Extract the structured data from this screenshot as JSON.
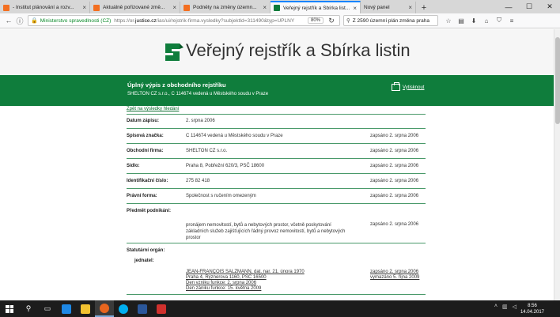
{
  "tabs": [
    {
      "title": "- Institut plánování a rozv...",
      "icon": "orange"
    },
    {
      "title": "Aktuálně pořizované změ...",
      "icon": "orange"
    },
    {
      "title": "Podněty na změny územn...",
      "icon": "orange"
    },
    {
      "title": "Veřejný rejstřík a Sbírka list...",
      "icon": "green",
      "active": true
    },
    {
      "title": "Nový panel",
      "icon": "none"
    }
  ],
  "nav": {
    "site_label": "Ministerstvo spravedlnosti (CZ)",
    "url_prefix": "https://or.",
    "url_domain": "justice.cz",
    "url_rest": "/ias/ui/rejstrik-firma.vysledky?subjektId=311490&typ=UPLNY",
    "zoom": "80%",
    "search_value": "Z 2590 územní plán změna praha"
  },
  "header": {
    "brand": "Veřejný rejstřík a Sbírka listin"
  },
  "greenbar": {
    "title": "Úplný výpis z obchodního rejstříku",
    "subtitle": "SHELTON CZ s.r.o., C 114674 vedená u Městského soudu v Praze",
    "print_label": "Vytisknout"
  },
  "content": {
    "back_link": "Zpět na výsledky hledání",
    "rows": [
      {
        "label": "Datum zápisu:",
        "value": "2. srpna 2006",
        "stamp": ""
      },
      {
        "label": "Spisová značka:",
        "value": "C 114674 vedená u Městského soudu v Praze",
        "stamp": "zapsáno 2. srpna 2006"
      },
      {
        "label": "Obchodní firma:",
        "value": "SHELTON CZ s.r.o.",
        "stamp": "zapsáno 2. srpna 2006"
      },
      {
        "label": "Sídlo:",
        "value": "Praha 8, Pobřežní 620/3, PSČ 18600",
        "stamp": "zapsáno 2. srpna 2006"
      },
      {
        "label": "Identifikační číslo:",
        "value": "275 82 418",
        "stamp": "zapsáno 2. srpna 2006"
      },
      {
        "label": "Právní forma:",
        "value": "Společnost s ručením omezeným",
        "stamp": "zapsáno 2. srpna 2006"
      }
    ],
    "predmet": {
      "label": "Předmět podnikání:",
      "value_lines": [
        "pronájem nemovitostí, bytů a nebytových prostor, včetně poskytování",
        "základních služeb zajišťujících řádný provoz nemovitostí, bytů a nebytových",
        "prostor"
      ],
      "stamp": "zapsáno 2. srpna 2006"
    },
    "statutarni": {
      "label": "Statutární orgán:",
      "sub_label": "jednatel:",
      "lines": [
        "JEAN-FRANÇOIS SALZMANN, dat. nar. 21. února 1970",
        "Praha 4, Rýznerova 1160, PSČ 16500",
        "Den vzniku funkce: 2. srpna 2006",
        "Den zániku funkce: 15. května 2009"
      ],
      "stamp1": "zapsáno 2. srpna 2006",
      "stamp2": "vymazáno 5. října 2009"
    }
  },
  "taskbar": {
    "time": "8:56",
    "date": "14.04.2017"
  },
  "colors": {
    "brand_green": "#0f7d3c",
    "tab_accent": "#0a84ff"
  }
}
